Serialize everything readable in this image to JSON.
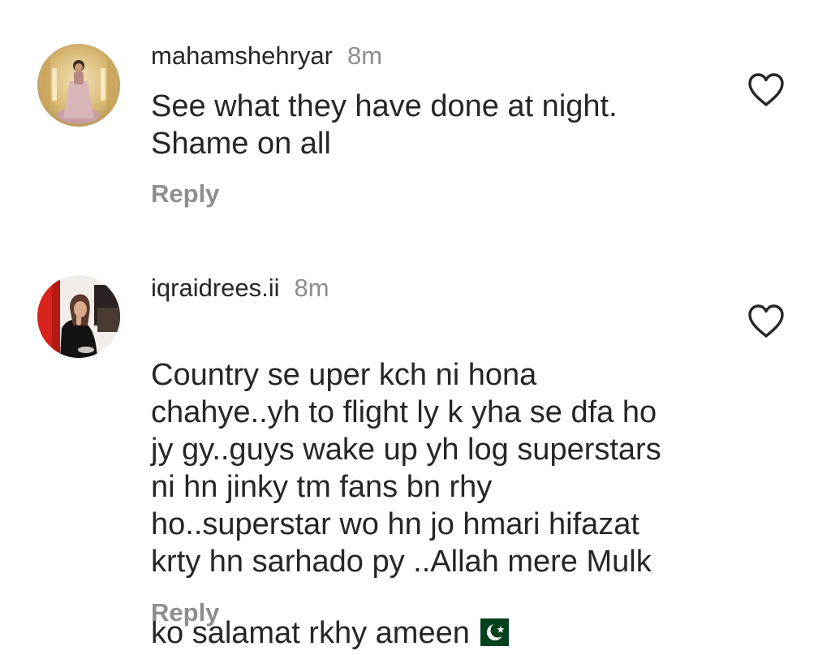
{
  "comments": [
    {
      "username": "mahamshehryar",
      "time": "8m",
      "text": "See what they have done at night.\nShame on all",
      "reply_label": "Reply",
      "avatar_icon": "user-avatar-photo",
      "like_icon": "heart-outline-icon"
    },
    {
      "username": "iqraidrees.ii",
      "time": "8m",
      "text": "Country se uper kch ni hona\nchahye..yh to flight ly k yha se dfa ho\njy gy..guys wake up yh log superstars\nni hn jinky tm fans bn rhy\nho..superstar wo hn jo hmari hifazat\nkrty hn sarhado py ..Allah mere Mulk\nko salamat rkhy ameen",
      "emoji": "pakistan-flag-emoji",
      "reply_label": "Reply",
      "avatar_icon": "user-avatar-photo",
      "like_icon": "heart-outline-icon"
    }
  ],
  "colors": {
    "text_primary": "#262626",
    "text_secondary": "#8e8e8e",
    "flag_green": "#01411c",
    "background": "#ffffff"
  }
}
